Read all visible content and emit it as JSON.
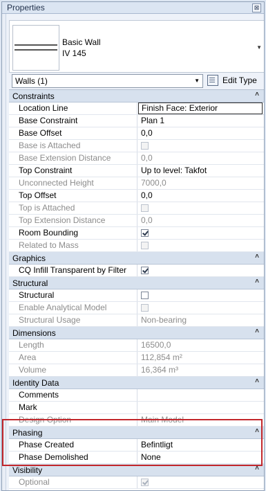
{
  "panel": {
    "title": "Properties",
    "close_glyph": "⊠"
  },
  "type_selector": {
    "family": "Basic Wall",
    "type": "IV 145"
  },
  "instance": {
    "selection": "Walls (1)",
    "edit_type_label": "Edit Type"
  },
  "groups": [
    {
      "name": "Constraints",
      "rows": [
        {
          "name": "Location Line",
          "value": "Finish Face: Exterior",
          "kind": "text",
          "enabled": true,
          "editing": true
        },
        {
          "name": "Base Constraint",
          "value": "Plan 1",
          "kind": "text",
          "enabled": true
        },
        {
          "name": "Base Offset",
          "value": "0,0",
          "kind": "text",
          "enabled": true
        },
        {
          "name": "Base is Attached",
          "checked": false,
          "kind": "check",
          "enabled": false
        },
        {
          "name": "Base Extension Distance",
          "value": "0,0",
          "kind": "text",
          "enabled": false
        },
        {
          "name": "Top Constraint",
          "value": "Up to level: Takfot",
          "kind": "text",
          "enabled": true
        },
        {
          "name": "Unconnected Height",
          "value": "7000,0",
          "kind": "text",
          "enabled": false
        },
        {
          "name": "Top Offset",
          "value": "0,0",
          "kind": "text",
          "enabled": true
        },
        {
          "name": "Top is Attached",
          "checked": false,
          "kind": "check",
          "enabled": false
        },
        {
          "name": "Top Extension Distance",
          "value": "0,0",
          "kind": "text",
          "enabled": false
        },
        {
          "name": "Room Bounding",
          "checked": true,
          "kind": "check",
          "enabled": true
        },
        {
          "name": "Related to Mass",
          "checked": false,
          "kind": "check",
          "enabled": false
        }
      ]
    },
    {
      "name": "Graphics",
      "rows": [
        {
          "name": "CQ Infill Transparent by Filter",
          "checked": true,
          "kind": "check",
          "enabled": true
        }
      ]
    },
    {
      "name": "Structural",
      "rows": [
        {
          "name": "Structural",
          "checked": false,
          "kind": "check",
          "enabled": true
        },
        {
          "name": "Enable Analytical Model",
          "checked": false,
          "kind": "check",
          "enabled": false
        },
        {
          "name": "Structural Usage",
          "value": "Non-bearing",
          "kind": "text",
          "enabled": false
        }
      ]
    },
    {
      "name": "Dimensions",
      "rows": [
        {
          "name": "Length",
          "value": "16500,0",
          "kind": "text",
          "enabled": false
        },
        {
          "name": "Area",
          "value": "112,854 m²",
          "kind": "text",
          "enabled": false
        },
        {
          "name": "Volume",
          "value": "16,364 m³",
          "kind": "text",
          "enabled": false
        }
      ]
    },
    {
      "name": "Identity Data",
      "rows": [
        {
          "name": "Comments",
          "value": "",
          "kind": "text",
          "enabled": true
        },
        {
          "name": "Mark",
          "value": "",
          "kind": "text",
          "enabled": true
        },
        {
          "name": "Design Option",
          "value": "Main Model",
          "kind": "text",
          "enabled": false
        }
      ]
    },
    {
      "name": "Phasing",
      "rows": [
        {
          "name": "Phase Created",
          "value": "Befintligt",
          "kind": "text",
          "enabled": true
        },
        {
          "name": "Phase Demolished",
          "value": "None",
          "kind": "text",
          "enabled": true
        }
      ]
    },
    {
      "name": "Visibility",
      "rows": [
        {
          "name": "Optional",
          "checked": true,
          "kind": "check",
          "enabled": false
        }
      ]
    }
  ],
  "colors": {
    "highlight": "#c2262b",
    "group_bg": "#d7e1ee",
    "disabled_text": "#8c8c8c"
  }
}
